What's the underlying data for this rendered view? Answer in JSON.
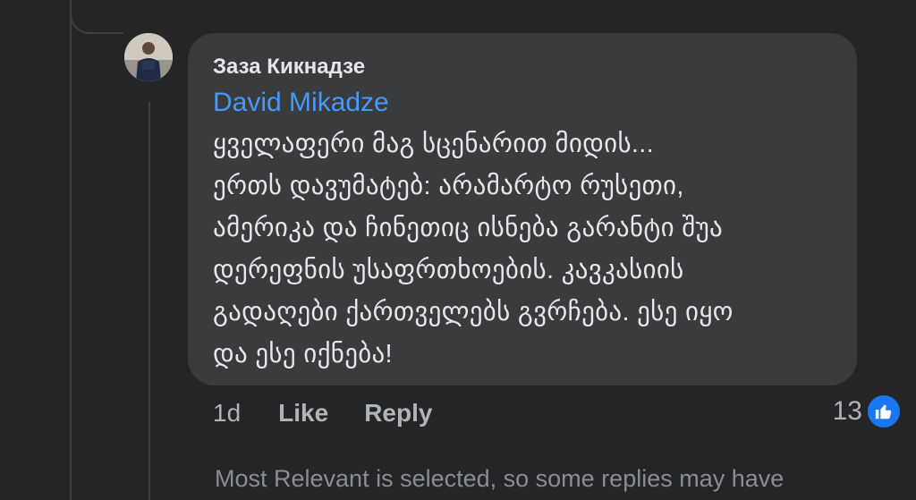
{
  "comment": {
    "author": "Заза Кикнадзе",
    "mention": "David Mikadze",
    "text": "ყველაფერი მაგ სცენარით მიდის...\nერთს დავუმატებ: არამარტო რუსეთი,\nამერიკა და ჩინეთიც ისნება გარანტი შუა\nდერეფნის უსაფრთხოების. კავკასიის\nგადაღები ქართველებს გვრჩება. ესე იყო\nდა ესე იქნება!",
    "time": "1d",
    "like_label": "Like",
    "reply_label": "Reply",
    "reaction_count": "13",
    "reaction_icon": "like-thumb-icon"
  },
  "notice": "Most Relevant is selected, so some replies may have",
  "colors": {
    "background": "#242526",
    "bubble": "#3a3b3c",
    "link": "#4599ff",
    "like_badge": "#1877f2"
  }
}
